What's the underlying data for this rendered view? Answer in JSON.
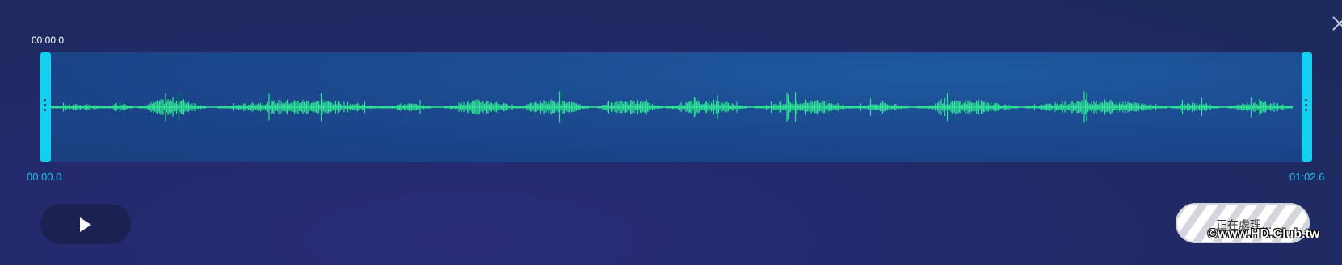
{
  "cursor_time": "00:00.0",
  "selection": {
    "start_time": "00:00.0",
    "end_time": "01:02.6"
  },
  "player": {
    "play_icon": "play-icon"
  },
  "processing_button": {
    "label": "正在處理..."
  },
  "watermark": "©www.HD.Club.tw",
  "colors": {
    "waveform": "#2ee596",
    "handle": "#12d0ef",
    "time_label": "#14c8ef"
  },
  "icons": [
    "close-icon",
    "play-icon",
    "grip-icon"
  ]
}
